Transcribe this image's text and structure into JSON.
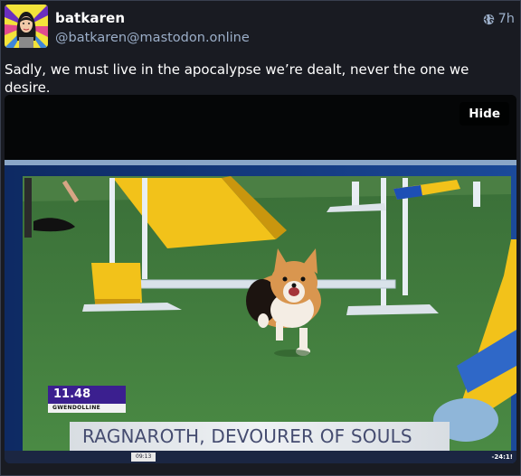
{
  "post": {
    "display_name": "batkaren",
    "handle": "@batkaren@mastodon.online",
    "relative_time": "7h",
    "visibility_icon": "globe-icon",
    "text": "Sadly, we must live in the apocalypse we’re dealt, never the one we desire."
  },
  "media": {
    "hide_label": "Hide",
    "overlay": {
      "score": "11.48",
      "score_label": "GWENDOLLINE",
      "caption": "RAGNAROTH, DEVOURER OF SOULS",
      "clock": "09:13",
      "ticker_right": "-24:1!"
    }
  },
  "colors": {
    "background": "#191b22",
    "secondary_text": "#9baec8",
    "caption_text": "#454c70",
    "score_box": "#3b1f8f",
    "turf": "#3f7a3c",
    "agility_yellow": "#f2c21a"
  }
}
